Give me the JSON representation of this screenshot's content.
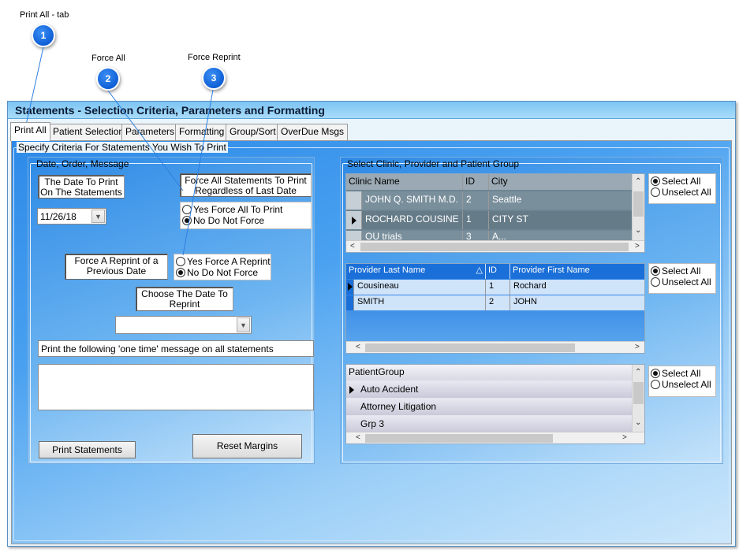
{
  "callouts": [
    {
      "number": "1",
      "label": "Print All - tab"
    },
    {
      "number": "2",
      "label": "Force All"
    },
    {
      "number": "3",
      "label": "Force Reprint"
    }
  ],
  "window": {
    "title": "Statements - Selection Criteria, Parameters and Formatting"
  },
  "tabs": [
    {
      "label": "Print All"
    },
    {
      "label": "Patient Selection"
    },
    {
      "label": "Parameters"
    },
    {
      "label": "Formatting"
    },
    {
      "label": "Group/Sort"
    },
    {
      "label": "OverDue Msgs"
    }
  ],
  "criteria": {
    "title": "Specify Criteria For Statements You Wish To Print"
  },
  "date_panel": {
    "title": "Date, Order, Message",
    "date_label": "The Date To Print On The Statements",
    "date_value": "11/26/18",
    "force_all_label": "Force All Statements To Print Regardless of Last Date Printe...",
    "force_yes": "Yes Force All To Print",
    "force_no": "No Do Not Force",
    "reprint_label": "Force A Reprint of a Previous Date",
    "reprint_yes": "Yes Force A Reprint",
    "reprint_no": "No Do Not Force",
    "choose_label": "Choose The Date To Reprint",
    "choose_value": "",
    "message_label": "Print the following 'one time' message on all statements",
    "message_value": "",
    "print_button": "Print Statements",
    "reset_button": "Reset Margins"
  },
  "select_panel": {
    "title": "Select Clinic, Provider and Patient Group",
    "select_all": "Select All",
    "unselect_all": "Unselect All",
    "clinic_grid": {
      "columns": [
        "Clinic Name",
        "ID",
        "City"
      ],
      "rows": [
        [
          "JOHN Q. SMITH M.D.",
          "2",
          "Seattle"
        ],
        [
          "ROCHARD COUSINE",
          "1",
          "CITY ST"
        ],
        [
          "OU trials",
          "3",
          "A..."
        ]
      ]
    },
    "provider_grid": {
      "columns": [
        "Provider Last Name",
        "ID",
        "Provider First Name"
      ],
      "rows": [
        [
          "Cousineau",
          "1",
          "Rochard"
        ],
        [
          "SMITH",
          "2",
          "JOHN"
        ]
      ]
    },
    "group_grid": {
      "columns": [
        "PatientGroup"
      ],
      "rows": [
        [
          "Auto Accident"
        ],
        [
          "Attorney Litigation"
        ],
        [
          "Grp 3"
        ]
      ]
    }
  }
}
